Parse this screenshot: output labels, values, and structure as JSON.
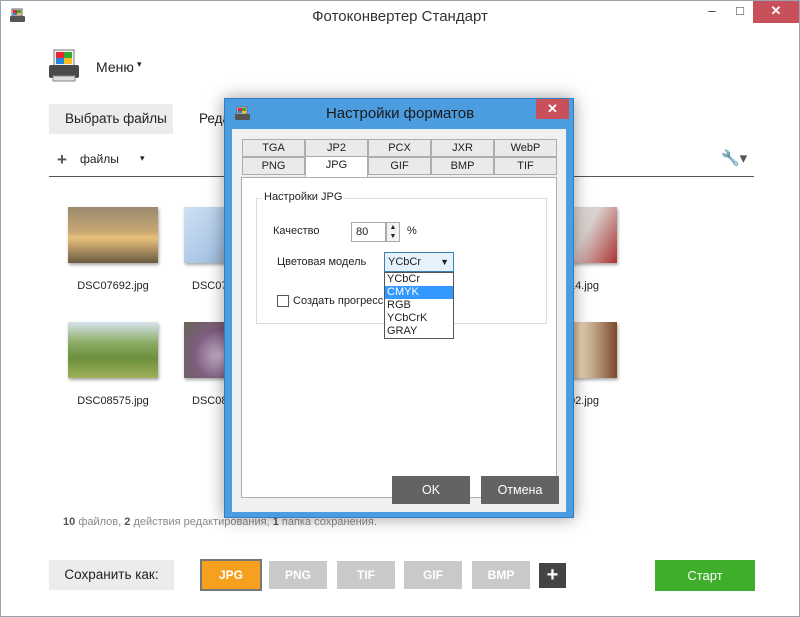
{
  "window": {
    "title": "Фотоконвертер Стандарт",
    "min_glyph": "–",
    "max_glyph": "□",
    "close_glyph": "✕"
  },
  "menu": {
    "label": "Меню",
    "caret": "▾"
  },
  "main_tabs": [
    {
      "label": "Выбрать файлы"
    },
    {
      "label": "Реда"
    }
  ],
  "toolbar": {
    "plus": "+",
    "files_label": "файлы",
    "caret": "▾",
    "wrench": "🔧▾"
  },
  "thumbnails": [
    {
      "name": "DSC07692.jpg"
    },
    {
      "name": "DSC07"
    },
    {
      "name": "14.jpg"
    },
    {
      "name": "DSC08575.jpg"
    },
    {
      "name": "DSC08"
    },
    {
      "name": "02.jpg"
    }
  ],
  "stats": {
    "files_count": "10",
    "files_text": "файлов,",
    "actions_count": "2",
    "actions_text": "действия редактирования,",
    "folders_count": "1",
    "folders_text": "папка сохранения."
  },
  "save": {
    "label": "Сохранить как:",
    "formats": [
      {
        "label": "JPG",
        "active": true
      },
      {
        "label": "PNG"
      },
      {
        "label": "TIF"
      },
      {
        "label": "GIF"
      },
      {
        "label": "BMP"
      }
    ],
    "add": "+",
    "start": "Старт"
  },
  "dialog": {
    "title": "Настройки форматов",
    "close": "✕",
    "tabs_row1": [
      "TGA",
      "JP2",
      "PCX",
      "JXR",
      "WebP"
    ],
    "tabs_row2": [
      "PNG",
      "JPG",
      "GIF",
      "BMP",
      "TIF"
    ],
    "selected_tab": "JPG",
    "group_title": "Настройки JPG",
    "quality_label": "Качество",
    "quality_value": "80",
    "quality_unit": "%",
    "color_model_label": "Цветовая модель",
    "color_model_value": "YCbCr",
    "color_model_options": [
      "YCbCr",
      "CMYK",
      "RGB",
      "YCbCrK",
      "GRAY"
    ],
    "highlighted_option": "CMYK",
    "progressive_label": "Создать прогресс",
    "ok": "OK",
    "cancel": "Отмена"
  },
  "colors": {
    "accent": "#4c9ce0",
    "active_format": "#f6a01f",
    "start": "#3fae2a",
    "close": "#c7505a"
  }
}
